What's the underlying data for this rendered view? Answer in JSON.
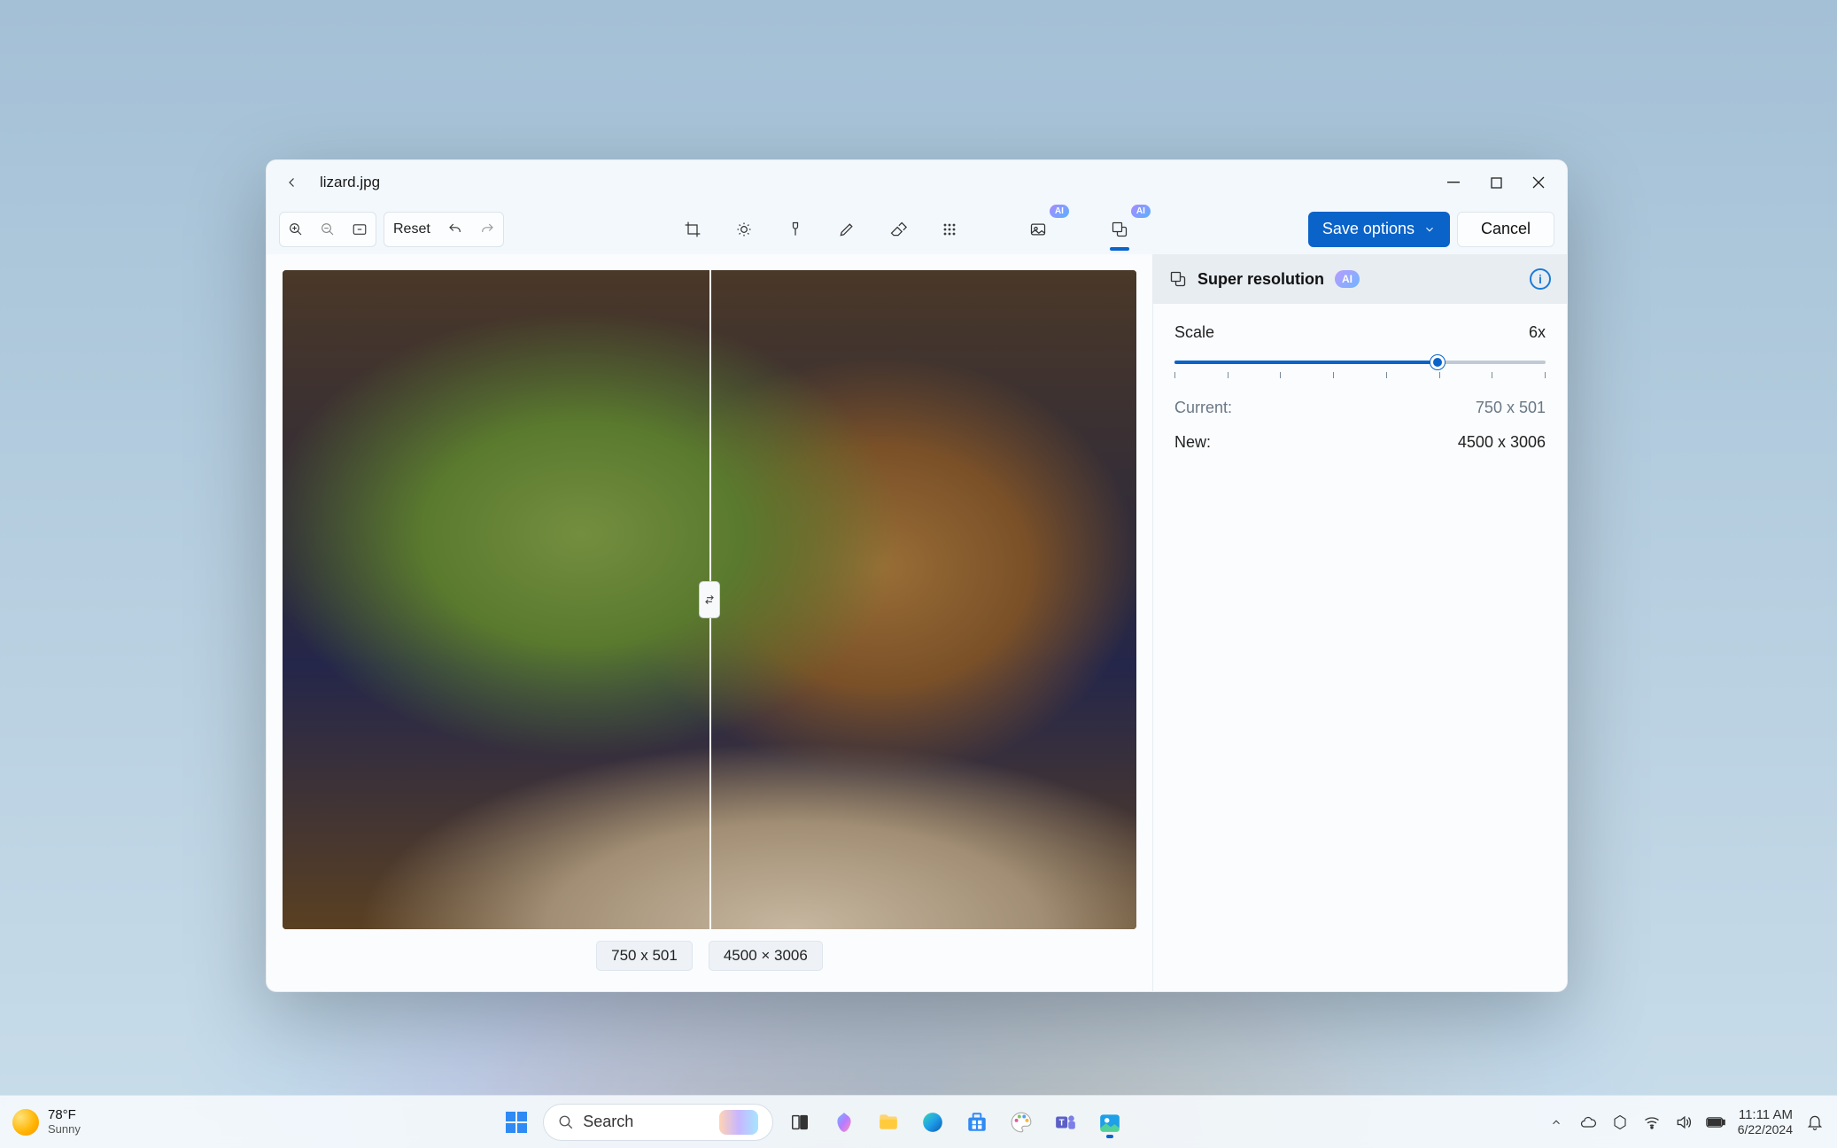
{
  "window": {
    "title": "lizard.jpg"
  },
  "toolbar": {
    "reset": "Reset",
    "ai_badge": "AI",
    "save_options": "Save options",
    "cancel": "Cancel"
  },
  "compare": {
    "left_dims": "750 x 501",
    "right_dims": "4500 × 3006"
  },
  "panel": {
    "title": "Super resolution",
    "ai_badge": "AI",
    "scale_label": "Scale",
    "scale_value": "6x",
    "ticks": 8,
    "slider_percent": 71,
    "current_label": "Current:",
    "current_value": "750 x 501",
    "new_label": "New:",
    "new_value": "4500 x 3006"
  },
  "taskbar": {
    "weather_temp": "78°F",
    "weather_cond": "Sunny",
    "search_label": "Search",
    "time": "11:11 AM",
    "date": "6/22/2024"
  }
}
